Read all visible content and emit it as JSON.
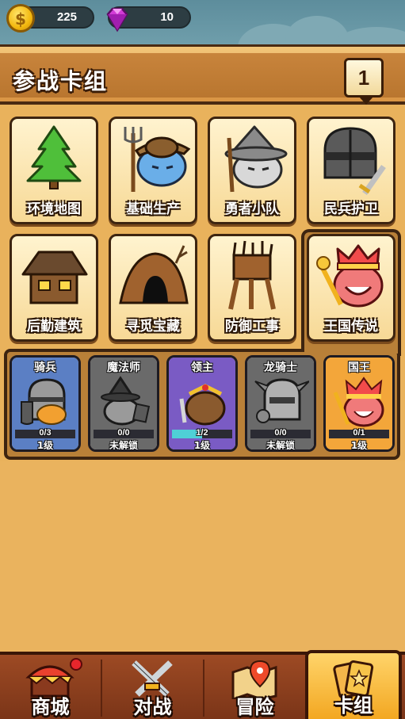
{
  "currency": {
    "coins": "225",
    "coin_symbol": "$",
    "gems": "10"
  },
  "header": {
    "title": "参战卡组",
    "deck_number": "1"
  },
  "categories": [
    {
      "label": "环境地图",
      "icon": "pine-tree-icon"
    },
    {
      "label": "基础生产",
      "icon": "farmer-pitchfork-icon"
    },
    {
      "label": "勇者小队",
      "icon": "wizard-hat-icon"
    },
    {
      "label": "民兵护卫",
      "icon": "knight-helmet-icon"
    },
    {
      "label": "后勤建筑",
      "icon": "house-icon"
    },
    {
      "label": "寻觅宝藏",
      "icon": "cave-icon"
    },
    {
      "label": "防御工事",
      "icon": "watchtower-icon"
    },
    {
      "label": "王国传说",
      "icon": "king-icon",
      "selected": true
    }
  ],
  "units": [
    {
      "name": "骑兵",
      "progress": "0/3",
      "fraction": 0.0,
      "level": "1级",
      "icon": "cavalry-knight-icon",
      "bg": "#5b7fc4"
    },
    {
      "name": "魔法师",
      "progress": "0/0",
      "fraction": 0.0,
      "level": "未解锁",
      "icon": "mage-icon",
      "bg": "#6a6a6a"
    },
    {
      "name": "领主",
      "progress": "1/2",
      "fraction": 0.5,
      "level": "1级",
      "icon": "lord-icon",
      "bg": "#7a5bc4"
    },
    {
      "name": "龙骑士",
      "progress": "0/0",
      "fraction": 0.0,
      "level": "未解锁",
      "icon": "dragon-knight-icon",
      "bg": "#6a6a6a"
    },
    {
      "name": "国王",
      "progress": "0/1",
      "fraction": 0.0,
      "level": "1级",
      "icon": "king-icon",
      "bg": "#f3a63a"
    }
  ],
  "nav": [
    {
      "label": "商城",
      "icon": "shop-tent-icon",
      "badge": true
    },
    {
      "label": "对战",
      "icon": "crossed-swords-icon"
    },
    {
      "label": "冒险",
      "icon": "map-pin-icon"
    },
    {
      "label": "卡组",
      "icon": "cards-icon",
      "active": true
    }
  ]
}
